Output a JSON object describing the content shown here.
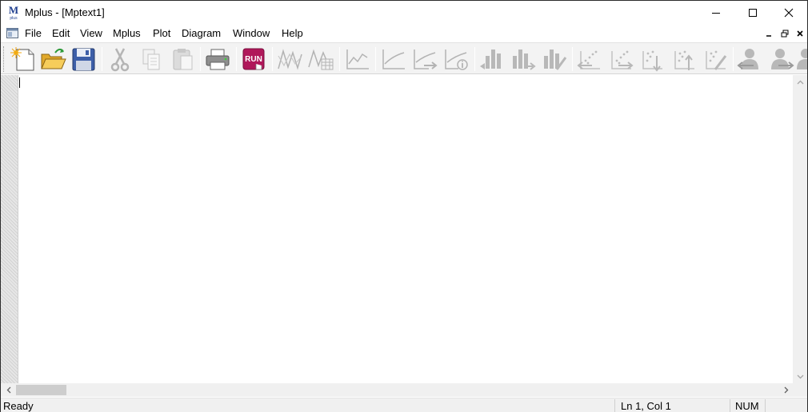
{
  "window": {
    "title": "Mplus - [Mptext1]",
    "logo_letter": "M",
    "logo_subtext": "plus",
    "accent_color": "#1f3f8f"
  },
  "menu": {
    "items": [
      "File",
      "Edit",
      "View",
      "Mplus",
      "Plot",
      "Diagram",
      "Window",
      "Help"
    ]
  },
  "toolbar": {
    "run_label": "RUN",
    "run_color": "#b0175a",
    "buttons": [
      "new-file-icon",
      "open-folder-icon",
      "save-icon",
      "cut-icon",
      "copy-icon",
      "paste-icon",
      "print-icon",
      "run-icon",
      "plot-lines-icon",
      "plot-lines-table-icon",
      "line-chart-icon",
      "trend-icon",
      "trend-arrow-icon",
      "trend-info-icon",
      "bar-left-icon",
      "bar-right-icon",
      "bar-edit-icon",
      "scatter-left-icon",
      "scatter-right-icon",
      "scatter-down-icon",
      "scatter-up-icon",
      "scatter-edit-icon",
      "person-left-icon",
      "person-right-icon",
      "person-more-icon"
    ]
  },
  "editor": {
    "content": ""
  },
  "status": {
    "ready": "Ready",
    "position": "Ln 1, Col 1",
    "num": "NUM"
  }
}
